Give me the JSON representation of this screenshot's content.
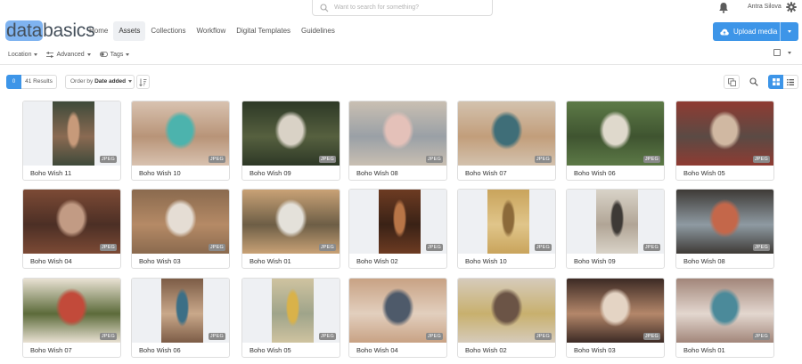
{
  "search": {
    "placeholder": "Want to search for something?"
  },
  "user": {
    "name": "Antra Silova"
  },
  "logo": {
    "part1": "data",
    "part2": "basics"
  },
  "nav": [
    {
      "label": "Home",
      "active": false
    },
    {
      "label": "Assets",
      "active": true
    },
    {
      "label": "Collections",
      "active": false
    },
    {
      "label": "Workflow",
      "active": false
    },
    {
      "label": "Digital Templates",
      "active": false
    },
    {
      "label": "Guidelines",
      "active": false
    }
  ],
  "upload": {
    "label": "Upload media"
  },
  "filters": [
    {
      "label": "Location",
      "icon": "none"
    },
    {
      "label": "Advanced",
      "icon": "sliders-icon"
    },
    {
      "label": "Tags",
      "icon": "tag-icon"
    }
  ],
  "toolbar": {
    "selected_count": "0",
    "results": "41 Results",
    "order_prefix": "Order by",
    "order_value": "Date added"
  },
  "colors": {
    "accent": "#3d95e8",
    "badge": "#8a8a8a"
  },
  "assets": [
    {
      "name": "Boho Wish 11",
      "type": "JPEG",
      "colors": [
        "#3e4a3a",
        "#c79a7a",
        "#8a6a52"
      ],
      "portrait": true
    },
    {
      "name": "Boho Wish 10",
      "type": "JPEG",
      "colors": [
        "#d8c2b0",
        "#4cb3ad",
        "#b89478"
      ],
      "portrait": false
    },
    {
      "name": "Boho Wish 09",
      "type": "JPEG",
      "colors": [
        "#2d3826",
        "#d9d2c6",
        "#56603f"
      ],
      "portrait": false
    },
    {
      "name": "Boho Wish 08",
      "type": "JPEG",
      "colors": [
        "#c9bfb2",
        "#e4c1b9",
        "#9aa0a6"
      ],
      "portrait": false
    },
    {
      "name": "Boho Wish 07",
      "type": "JPEG",
      "colors": [
        "#d3c2ae",
        "#3f6e78",
        "#c29e7b"
      ],
      "portrait": false
    },
    {
      "name": "Boho Wish 06",
      "type": "JPEG",
      "colors": [
        "#5d7a47",
        "#dfd9cc",
        "#3f5430"
      ],
      "portrait": false
    },
    {
      "name": "Boho Wish 05",
      "type": "JPEG",
      "colors": [
        "#8f3b32",
        "#d0b8a2",
        "#5b4a44"
      ],
      "portrait": false
    },
    {
      "name": "Boho Wish 04",
      "type": "JPEG",
      "colors": [
        "#7c4a35",
        "#c29b84",
        "#4c2f25"
      ],
      "portrait": false
    },
    {
      "name": "Boho Wish 03",
      "type": "JPEG",
      "colors": [
        "#8a6a4e",
        "#e5ddd4",
        "#b58a66"
      ],
      "portrait": false
    },
    {
      "name": "Boho Wish 01",
      "type": "JPEG",
      "colors": [
        "#c9a276",
        "#e4e1da",
        "#6d5e46"
      ],
      "portrait": false
    },
    {
      "name": "Boho Wish 02",
      "type": "JPEG",
      "colors": [
        "#6d3b22",
        "#b87547",
        "#3a2216"
      ],
      "portrait": true
    },
    {
      "name": "Boho Wish 10",
      "type": "JPEG",
      "colors": [
        "#c9a45c",
        "#8c6a3a",
        "#e0c58a"
      ],
      "portrait": true
    },
    {
      "name": "Boho Wish 09",
      "type": "JPEG",
      "colors": [
        "#d9d3c8",
        "#3e3a36",
        "#b1a596"
      ],
      "portrait": true
    },
    {
      "name": "Boho Wish 08",
      "type": "JPEG",
      "colors": [
        "#3e3a36",
        "#c4674a",
        "#8e9aa2"
      ],
      "portrait": false
    },
    {
      "name": "Boho Wish 07",
      "type": "JPEG",
      "colors": [
        "#e9e1d3",
        "#c24a3a",
        "#5c6b3a"
      ],
      "portrait": false
    },
    {
      "name": "Boho Wish 06",
      "type": "JPEG",
      "colors": [
        "#7c5c46",
        "#3c6f86",
        "#c9a88a"
      ],
      "portrait": true
    },
    {
      "name": "Boho Wish 05",
      "type": "JPEG",
      "colors": [
        "#cfc3a0",
        "#d9b24a",
        "#9fa48a"
      ],
      "portrait": true
    },
    {
      "name": "Boho Wish 04",
      "type": "JPEG",
      "colors": [
        "#c8a284",
        "#4e5a6a",
        "#e2cfbe"
      ],
      "portrait": false
    },
    {
      "name": "Boho Wish 02",
      "type": "JPEG",
      "colors": [
        "#d6cbbb",
        "#6b5446",
        "#c8b06e"
      ],
      "portrait": false
    },
    {
      "name": "Boho Wish 03",
      "type": "JPEG",
      "colors": [
        "#3c2a24",
        "#e4d4c4",
        "#b4876a"
      ],
      "portrait": false
    },
    {
      "name": "Boho Wish 01",
      "type": "JPEG",
      "colors": [
        "#a2867a",
        "#4b8a9a",
        "#e3d7cf"
      ],
      "portrait": false
    }
  ]
}
